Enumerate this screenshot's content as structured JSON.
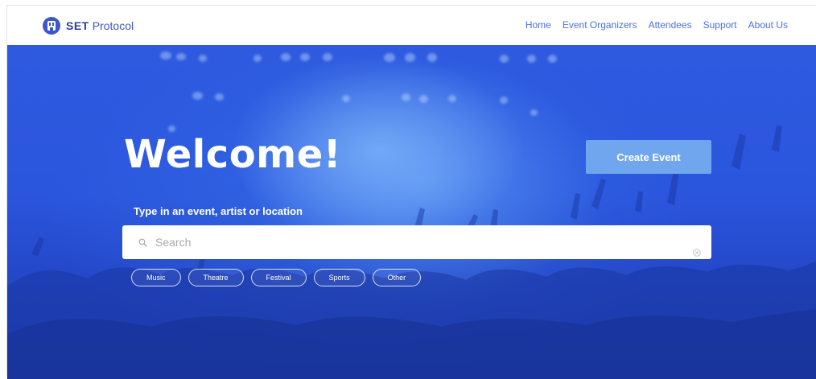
{
  "brand": {
    "name_bold": "SET",
    "name_light": "Protocol",
    "logo_icon": "set-protocol-logo-icon",
    "brand_color": "#3d56c9"
  },
  "nav": {
    "links": [
      {
        "label": "Home"
      },
      {
        "label": "Event Organizers"
      },
      {
        "label": "Attendees"
      },
      {
        "label": "Support"
      },
      {
        "label": "About Us"
      }
    ]
  },
  "hero": {
    "heading": "Welcome!",
    "create_button": "Create Event",
    "search_prompt": "Type in an event, artist or location",
    "search": {
      "placeholder": "Search",
      "value": ""
    },
    "categories": [
      {
        "label": "Music"
      },
      {
        "label": "Theatre"
      },
      {
        "label": "Festival"
      },
      {
        "label": "Sports"
      },
      {
        "label": "Other"
      }
    ],
    "accent_color": "#2e5ae0",
    "button_color": "#6fa6ee"
  }
}
